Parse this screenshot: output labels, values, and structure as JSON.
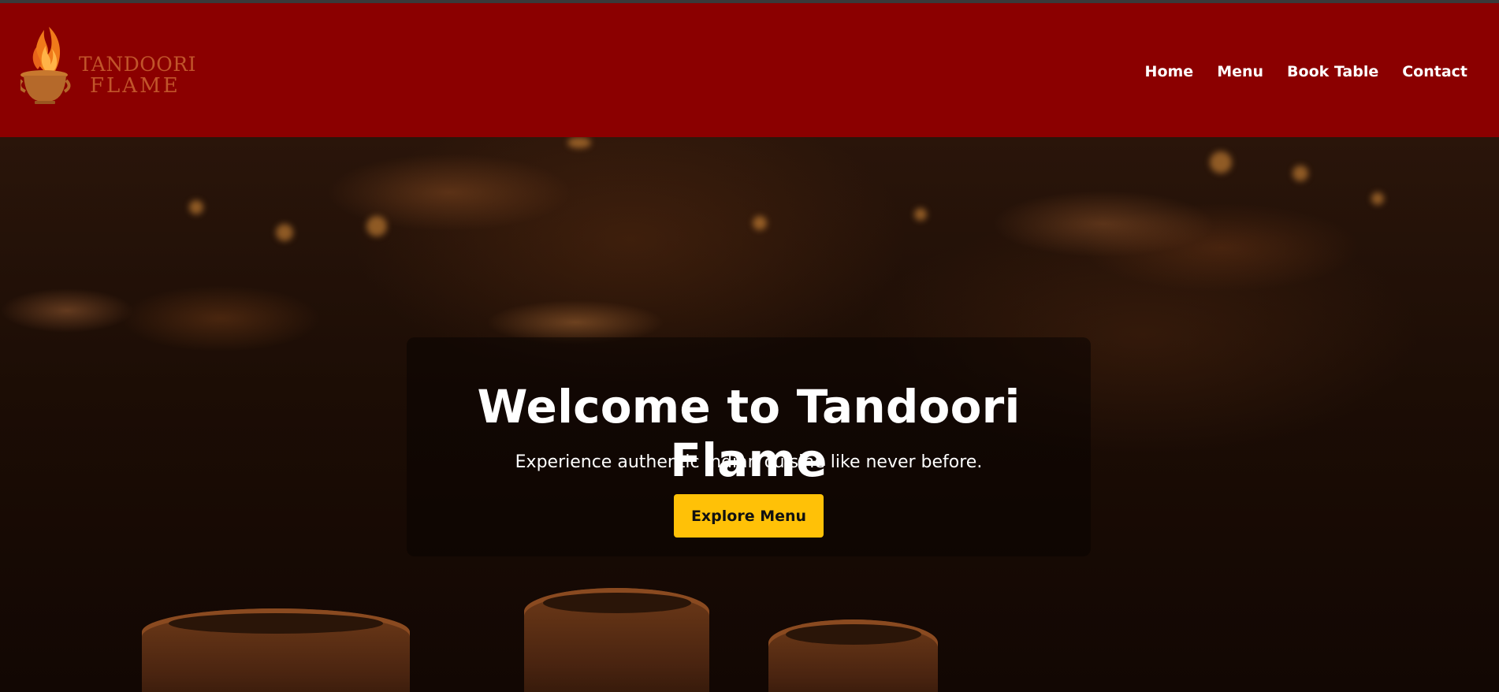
{
  "brand": {
    "name_line1": "TANDOORI",
    "name_line2": "FLAME",
    "logo_icon": "flame-pot-icon",
    "header_color": "#8b0000",
    "logo_text_color": "#c1552a"
  },
  "nav": {
    "items": [
      {
        "label": "Home"
      },
      {
        "label": "Menu"
      },
      {
        "label": "Book Table"
      },
      {
        "label": "Contact"
      }
    ]
  },
  "hero": {
    "title": "Welcome to Tandoori Flame",
    "subtitle": "Experience authentic Indian cuisine like never before.",
    "cta_label": "Explore Menu",
    "cta_color": "#ffc107"
  }
}
